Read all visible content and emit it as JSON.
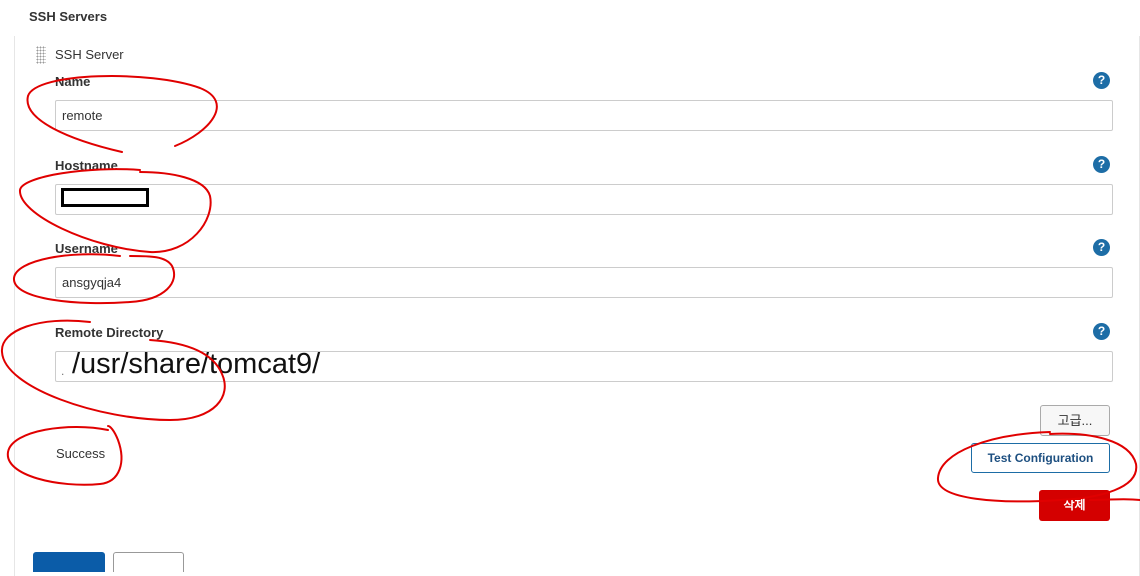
{
  "section": {
    "title": "SSH Servers"
  },
  "server": {
    "title": "SSH Server",
    "fields": {
      "name": {
        "label": "Name",
        "value": "remote"
      },
      "hostname": {
        "label": "Hostname",
        "value": ""
      },
      "username": {
        "label": "Username",
        "value": "ansgyqja4"
      },
      "remote_dir": {
        "label": "Remote Directory",
        "value": "/usr/share/tomcat9/",
        "prefix": "."
      }
    },
    "help_icon": "?",
    "advanced_label": "고급...",
    "status": "Success",
    "test_label": "Test Configuration",
    "delete_label": "삭제"
  },
  "annotations": {
    "color": "#e00000"
  },
  "colors": {
    "accent": "#1d6da6",
    "danger": "#d40000",
    "primary": "#0b5ca8"
  }
}
